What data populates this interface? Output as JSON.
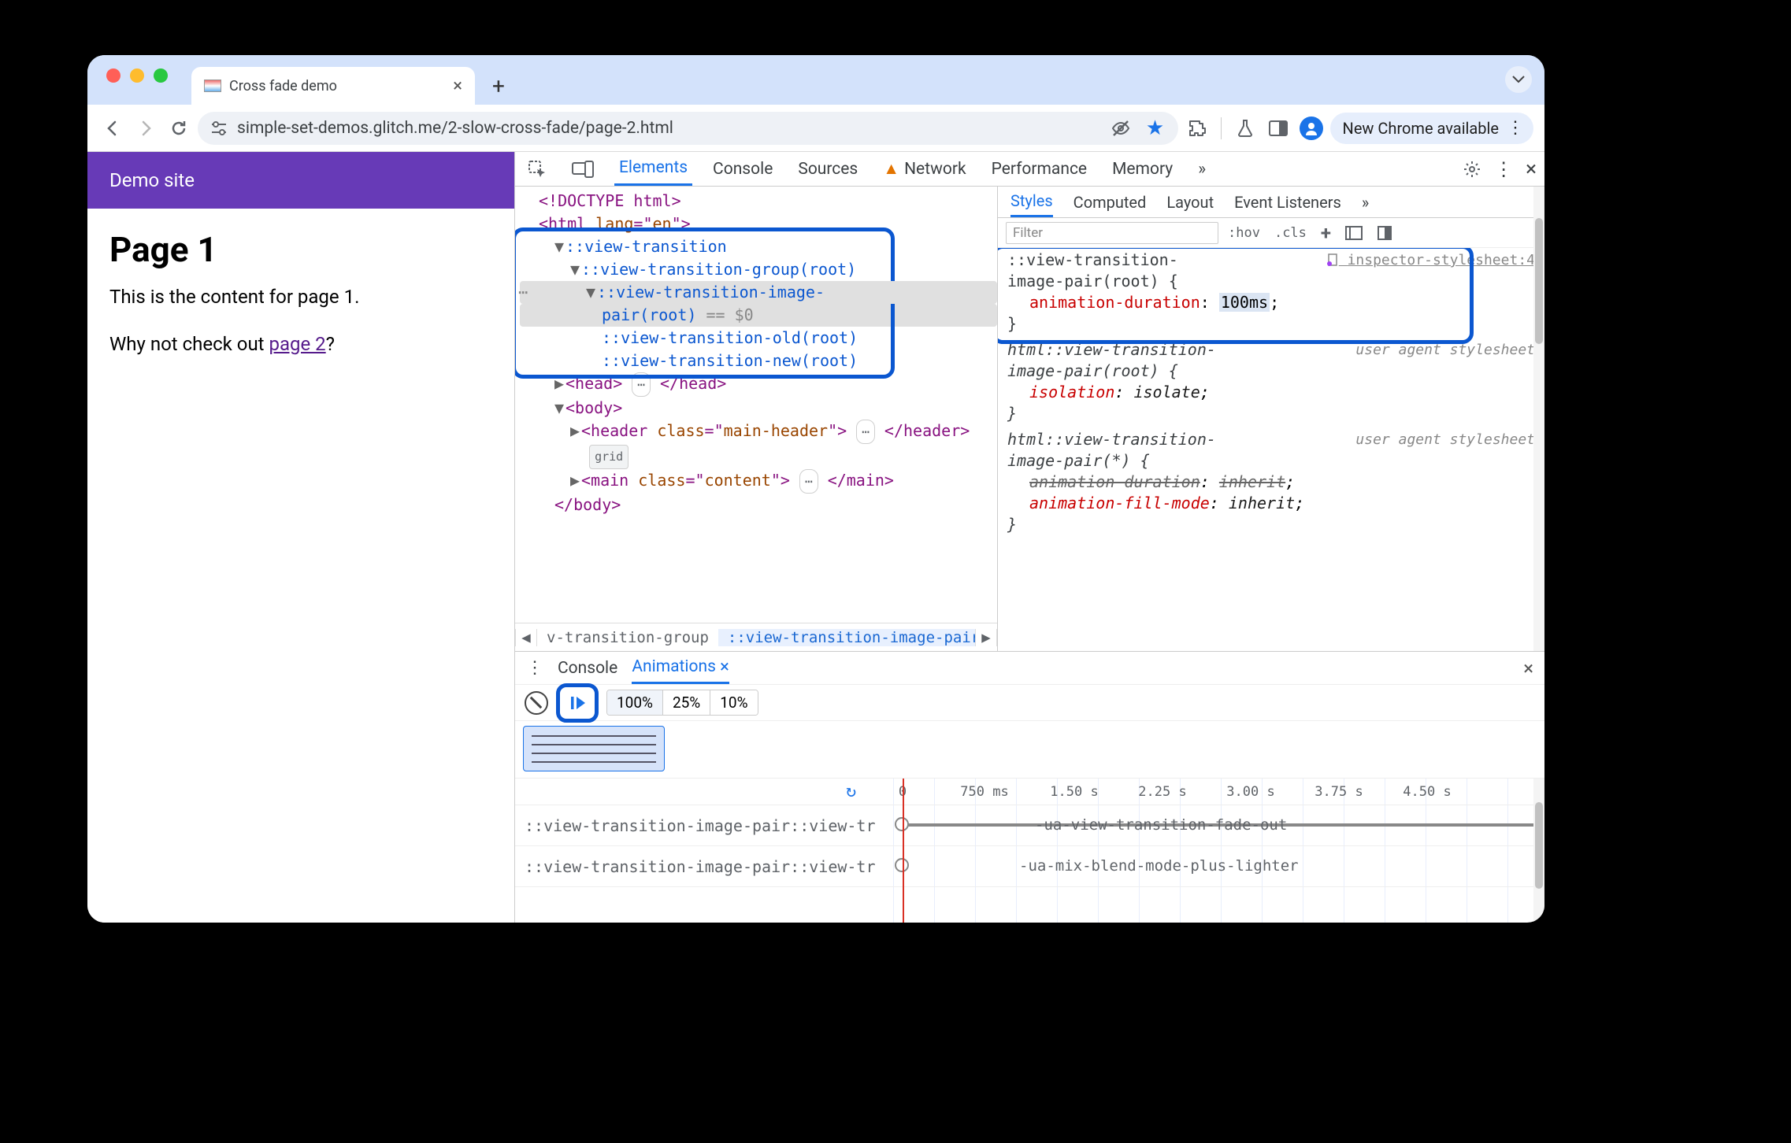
{
  "browser": {
    "tab_title": "Cross fade demo",
    "url": "simple-set-demos.glitch.me/2-slow-cross-fade/page-2.html",
    "update_chip": "New Chrome available"
  },
  "page": {
    "header": "Demo site",
    "h1": "Page 1",
    "para1": "This is the content for page 1.",
    "para2_pre": "Why not check out ",
    "link": "page 2",
    "para2_post": "?"
  },
  "devtools": {
    "tabs": {
      "elements": "Elements",
      "console": "Console",
      "sources": "Sources",
      "network": "Network",
      "performance": "Performance",
      "memory": "Memory",
      "more": "»"
    },
    "dom": {
      "doctype": "<!DOCTYPE html>",
      "html_open": "<html lang=\"en\">",
      "vt": "::view-transition",
      "vt_group": "::view-transition-group(root)",
      "vt_pair1": "::view-transition-image-",
      "vt_pair2": "pair(root)",
      "eq0": " == $0",
      "vt_old": "::view-transition-old(root)",
      "vt_new": "::view-transition-new(root)",
      "head_open": "<head>",
      "head_close": "</head>",
      "body_open": "<body>",
      "header_open": "<header class=\"main-header\">",
      "header_close": "</header>",
      "grid_badge": "grid",
      "main_open": "<main class=\"content\">",
      "main_close": "</main>",
      "body_close": "</body>",
      "ellipsis": "⋯"
    },
    "breadcrumb": {
      "bc1": "v-transition-group",
      "bc2": "::view-transition-image-pair"
    },
    "styles": {
      "tabs": {
        "styles": "Styles",
        "computed": "Computed",
        "layout": "Layout",
        "listeners": "Event Listeners",
        "more": "»"
      },
      "filter_placeholder": "Filter",
      "tb": {
        "hov": ":hov",
        "cls": ".cls",
        "plus": "+"
      },
      "rule1": {
        "sel": "::view-transition-image-pair(root) {",
        "src": "inspector-stylesheet:4",
        "p1n": "animation-duration",
        "p1v": "100ms",
        "close": "}"
      },
      "rule2": {
        "sel": "html::view-transition-image-pair(root) {",
        "src": "user agent stylesheet",
        "p1n": "isolation",
        "p1v": "isolate",
        "close": "}"
      },
      "rule3": {
        "sel": "html::view-transition-image-pair(*) {",
        "src": "user agent stylesheet",
        "p1n": "animation-duration",
        "p1v": "inherit",
        "p2n": "animation-fill-mode",
        "p2v": "inherit",
        "close": "}"
      }
    }
  },
  "drawer": {
    "tabs": {
      "console": "Console",
      "animations": "Animations"
    },
    "tab_close": "×",
    "speeds": {
      "s100": "100%",
      "s25": "25%",
      "s10": "10%"
    },
    "timeline": {
      "t0": "0",
      "t1": "750 ms",
      "t2": "1.50 s",
      "t3": "2.25 s",
      "t4": "3.00 s",
      "t5": "3.75 s",
      "t6": "4.50 s"
    },
    "track1_name": "::view-transition-image-pair::view-tr",
    "track1_anim": "-ua-view-transition-fade-out",
    "track2_name": "::view-transition-image-pair::view-tr",
    "track2_anim": "-ua-mix-blend-mode-plus-lighter"
  }
}
